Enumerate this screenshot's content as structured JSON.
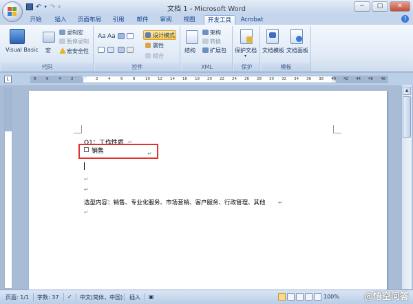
{
  "window": {
    "title": "文档 1 - Microsoft Word",
    "buttons": [
      "─",
      "□",
      "✕"
    ]
  },
  "tabs": [
    {
      "label": "开始",
      "active": false
    },
    {
      "label": "插入",
      "active": false
    },
    {
      "label": "页面布局",
      "active": false
    },
    {
      "label": "引用",
      "active": false
    },
    {
      "label": "邮件",
      "active": false
    },
    {
      "label": "审阅",
      "active": false
    },
    {
      "label": "视图",
      "active": false
    },
    {
      "label": "开发工具",
      "active": true
    },
    {
      "label": "Acrobat",
      "active": false
    }
  ],
  "ribbon": {
    "code_group": {
      "label": "代码",
      "visual_basic": "Visual Basic",
      "macros": "宏",
      "record_macro": "录制宏",
      "pause_recording": "暂停录制",
      "macro_security": "宏安全性"
    },
    "controls_group": {
      "label": "控件",
      "design_mode": "设计模式",
      "properties": "属性",
      "group": "组合"
    },
    "xml_group": {
      "label": "XML",
      "structure": "结构",
      "schema": "架构",
      "transform": "转换",
      "expansion_pack": "扩展包"
    },
    "protect_group": {
      "label": "保护",
      "protect_document": "保护文档"
    },
    "templates_group": {
      "label": "模板",
      "document_template": "文档模板",
      "document_panel": "文档面板"
    }
  },
  "ruler": {
    "ticks": [
      "8",
      "6",
      "4",
      "2",
      "",
      "2",
      "4",
      "6",
      "8",
      "10",
      "12",
      "14",
      "16",
      "18",
      "20",
      "22",
      "24",
      "26",
      "28",
      "30",
      "32",
      "34",
      "36",
      "38",
      "40",
      "42",
      "44",
      "46",
      "48"
    ]
  },
  "document": {
    "question": "Q1：工作性质",
    "checkbox_label": "销售",
    "options_line": "选型内容：销售、专业化服务、市场营销、客户服务、行政管理、其他",
    "para_mark": "↵"
  },
  "statusbar": {
    "page": "页面: 1/1",
    "words": "字数: 37",
    "language": "中文(简体，中国)",
    "mode": "插入",
    "zoom": "100%"
  },
  "watermark": "@悟空问答",
  "colors": {
    "accent_red": "#e0322c",
    "ribbon_bg": "#dfe9f6",
    "active_button": "#f8c94f"
  }
}
